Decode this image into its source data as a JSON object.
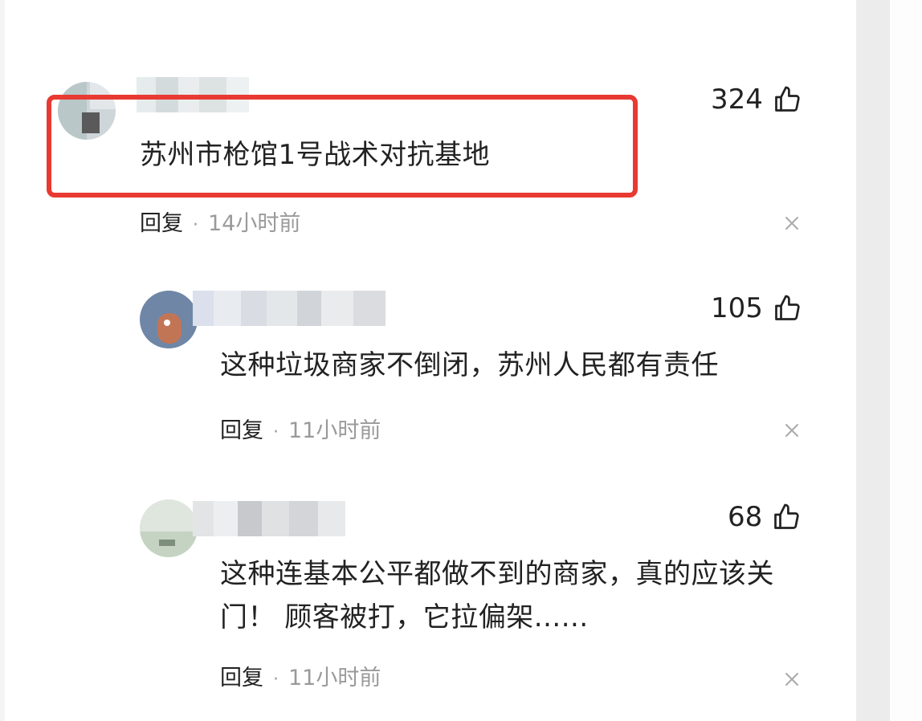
{
  "comments": [
    {
      "likes": "324",
      "text": "苏州市枪馆1号战术对抗基地",
      "reply_label": "回复",
      "separator": "·",
      "time": "14小时前"
    },
    {
      "likes": "105",
      "text": "这种垃圾商家不倒闭，苏州人民都有责任",
      "reply_label": "回复",
      "separator": "·",
      "time": "11小时前"
    },
    {
      "likes": "68",
      "text_lines": [
        "这种连基本公平都做不到的商家，真的应该关",
        "门！ 顾客被打，它拉偏架......"
      ],
      "reply_label": "回复",
      "separator": "·",
      "time": "11小时前"
    }
  ],
  "icons": {
    "like": "thumbs-up-icon",
    "close": "close-icon"
  },
  "colors": {
    "highlight": "#e83a32",
    "muted": "#9a9a9a",
    "text": "#222222"
  }
}
